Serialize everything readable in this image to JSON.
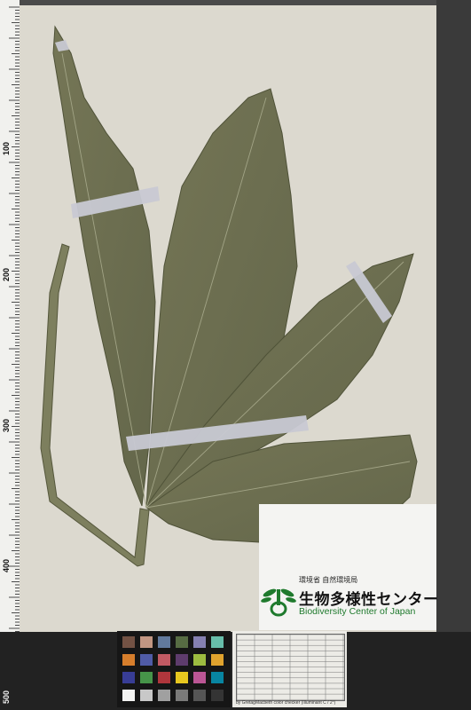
{
  "ruler": {
    "labels": [
      "100",
      "200",
      "300",
      "400",
      "500"
    ]
  },
  "logo": {
    "ministry": "環境省 自然環境局",
    "center_jp": "生物多様性センター",
    "center_en": "Biodiversity Center of Japan"
  },
  "color_card": {
    "caption": "by GretagMacbeth color checker (Illuminant C / 2°)"
  },
  "colors": {
    "leaf": "#6e7050",
    "paper": "#dcd9cf",
    "tape": "#c8c9d3",
    "logo_green": "#1f7a2d"
  }
}
